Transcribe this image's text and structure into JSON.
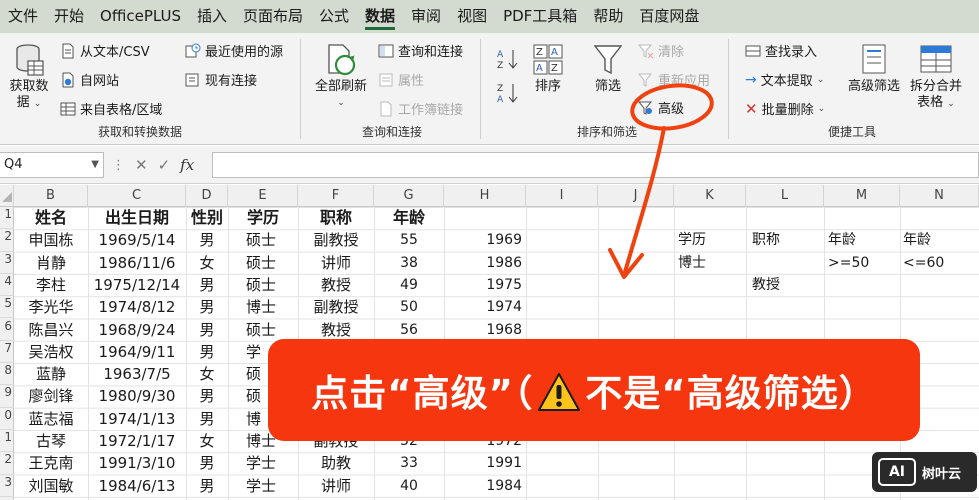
{
  "menu": [
    "文件",
    "开始",
    "OfficePLUS",
    "插入",
    "页面布局",
    "公式",
    "数据",
    "审阅",
    "视图",
    "PDF工具箱",
    "帮助",
    "百度网盘"
  ],
  "menu_active": "数据",
  "ribbon": {
    "get_data": "获取数",
    "get_data2": "据",
    "from_text": "从文本/CSV",
    "from_web": "自网站",
    "from_table": "来自表格/区域",
    "recent_sources": "最近使用的源",
    "existing_conn": "现有连接",
    "group_get": "获取和转换数据",
    "refresh_all": "全部刷新",
    "queries_conn": "查询和连接",
    "properties": "属性",
    "edit_links": "工作簿链接",
    "group_query": "查询和连接",
    "sort": "排序",
    "filter": "筛选",
    "clear": "清除",
    "reapply": "重新应用",
    "advanced": "高级",
    "group_sort": "排序和筛选",
    "find_entry": "查找录入",
    "text_extract": "文本提取",
    "batch_delete": "批量删除",
    "adv_filter": "高级筛选",
    "split_merge": "拆分合并",
    "split_merge2": "表格",
    "group_tools": "便捷工具"
  },
  "namebox": "Q4",
  "columns": [
    "B",
    "C",
    "D",
    "E",
    "F",
    "G",
    "H",
    "I",
    "J",
    "K",
    "L",
    "M",
    "N"
  ],
  "rows": [
    "1",
    "2",
    "3",
    "4",
    "5",
    "6",
    "7",
    "8",
    "9",
    "0",
    "1",
    "2",
    "3"
  ],
  "headers": [
    "姓名",
    "出生日期",
    "性别",
    "学历",
    "职称",
    "年龄"
  ],
  "table": [
    [
      "申国栋",
      "1969/5/14",
      "男",
      "硕士",
      "副教授",
      "55",
      "1969"
    ],
    [
      "肖静",
      "1986/11/6",
      "女",
      "硕士",
      "讲师",
      "38",
      "1986"
    ],
    [
      "李柱",
      "1975/12/14",
      "男",
      "硕士",
      "教授",
      "49",
      "1975"
    ],
    [
      "李光华",
      "1974/8/12",
      "男",
      "博士",
      "副教授",
      "50",
      "1974"
    ],
    [
      "陈昌兴",
      "1968/9/24",
      "男",
      "硕士",
      "教授",
      "56",
      "1968"
    ],
    [
      "吴浩权",
      "1964/9/11",
      "男",
      "学",
      "",
      "",
      ""
    ],
    [
      "蓝静",
      "1963/7/5",
      "女",
      "硕",
      "",
      "",
      ""
    ],
    [
      "廖剑锋",
      "1980/9/30",
      "男",
      "硕",
      "",
      "",
      ""
    ],
    [
      "蓝志福",
      "1974/1/13",
      "男",
      "博",
      "",
      "",
      ""
    ],
    [
      "古琴",
      "1972/1/17",
      "女",
      "博士",
      "副教授",
      "52",
      "1972"
    ],
    [
      "王克南",
      "1991/3/10",
      "男",
      "学士",
      "助教",
      "33",
      "1991"
    ],
    [
      "刘国敏",
      "1984/6/13",
      "男",
      "学士",
      "讲师",
      "40",
      "1984"
    ]
  ],
  "criteria": {
    "header": [
      "学历",
      "职称",
      "年龄",
      "年龄"
    ],
    "row1": [
      "博士",
      "",
      ">=50",
      "<=60"
    ],
    "row2": [
      "",
      "教授",
      "",
      ""
    ]
  },
  "callout": {
    "part1": "点击“高级”（",
    "part2": "不是“高级筛选）"
  },
  "watermark": "树叶云",
  "watermark_logo": "AI",
  "colors": {
    "menubar": "#d3dbd1",
    "accent": "#1e6b3a",
    "callout": "#f5360f",
    "annotation": "#f0420f"
  }
}
